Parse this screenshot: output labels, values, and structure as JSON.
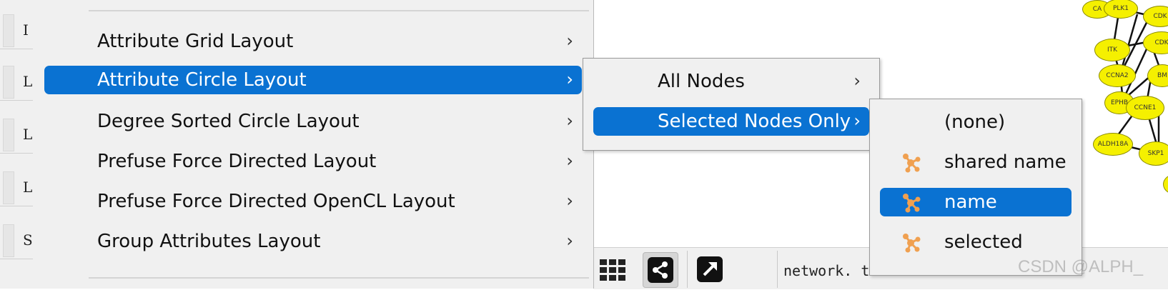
{
  "left_strip": {
    "cells": [
      "I",
      "L",
      "L",
      "L",
      "S"
    ]
  },
  "layout_menu": {
    "items": [
      {
        "label": "Attribute Grid Layout",
        "arrow": "›"
      },
      {
        "label": "Attribute Circle Layout",
        "arrow": "›",
        "selected": true
      },
      {
        "label": "Degree Sorted Circle Layout",
        "arrow": "›"
      },
      {
        "label": "Prefuse Force Directed Layout",
        "arrow": "›"
      },
      {
        "label": "Prefuse Force Directed OpenCL Layout",
        "arrow": "›"
      },
      {
        "label": "Group Attributes Layout",
        "arrow": "›"
      }
    ]
  },
  "node_scope_menu": {
    "items": [
      {
        "label": "All Nodes",
        "arrow": "›"
      },
      {
        "label": "Selected Nodes Only",
        "arrow": "›",
        "selected": true
      }
    ]
  },
  "attribute_menu": {
    "items": [
      {
        "label": "(none)",
        "icon": null
      },
      {
        "label": "shared name",
        "icon": "network-attribute-icon"
      },
      {
        "label": "name",
        "icon": "network-attribute-icon",
        "selected": true
      },
      {
        "label": "selected",
        "icon": "network-attribute-icon"
      }
    ]
  },
  "network_nodes": [
    "CA",
    "PLK1",
    "CDK",
    "ITK",
    "CDK",
    "CCNA2",
    "BM",
    "EPHB",
    "CCNE1",
    "ALDH18A",
    "SKP1"
  ],
  "toolbar": {
    "network_label": "network. t..."
  },
  "watermark": "CSDN @ALPH_",
  "colors": {
    "selection": "#0a72d2",
    "menu_bg": "#f0f0f0",
    "node_fill": "#f5f000",
    "icon_orange": "#f0a050"
  }
}
